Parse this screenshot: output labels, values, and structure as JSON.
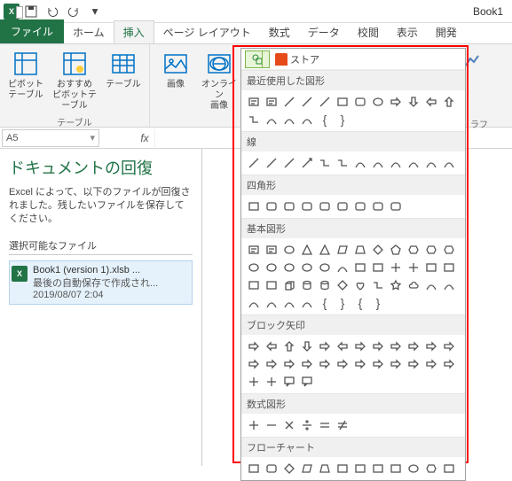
{
  "titlebar": {
    "book_name": "Book1"
  },
  "tabs": {
    "file": "ファイル",
    "home": "ホーム",
    "insert": "挿入",
    "page_layout": "ページ レイアウト",
    "formulas": "数式",
    "data": "データ",
    "review": "校閲",
    "view": "表示",
    "developer": "開発"
  },
  "ribbon": {
    "pivot_table": "ピボット\nテーブル",
    "recommended_pivot": "おすすめ\nピボットテーブル",
    "table": "テーブル",
    "picture": "画像",
    "online_picture": "オンライン\n画像",
    "group_tables": "テーブル",
    "group_charts": "ラフ"
  },
  "namebox": {
    "cell": "A5"
  },
  "recovery": {
    "title": "ドキュメントの回復",
    "desc": "Excel によって、以下のファイルが回復されました。残したいファイルを保存してください。",
    "subhead": "選択可能なファイル",
    "item": {
      "name": "Book1 (version 1).xlsb ...",
      "line2": "最後の自動保存で作成され...",
      "line3": "2019/08/07 2:04"
    }
  },
  "shapes": {
    "store": "ストア",
    "cat_recent": "最近使用した図形",
    "cat_lines": "線",
    "cat_rects": "四角形",
    "cat_basic": "基本図形",
    "cat_block_arrows": "ブロック矢印",
    "cat_equation": "数式図形",
    "cat_flowchart": "フローチャート"
  }
}
